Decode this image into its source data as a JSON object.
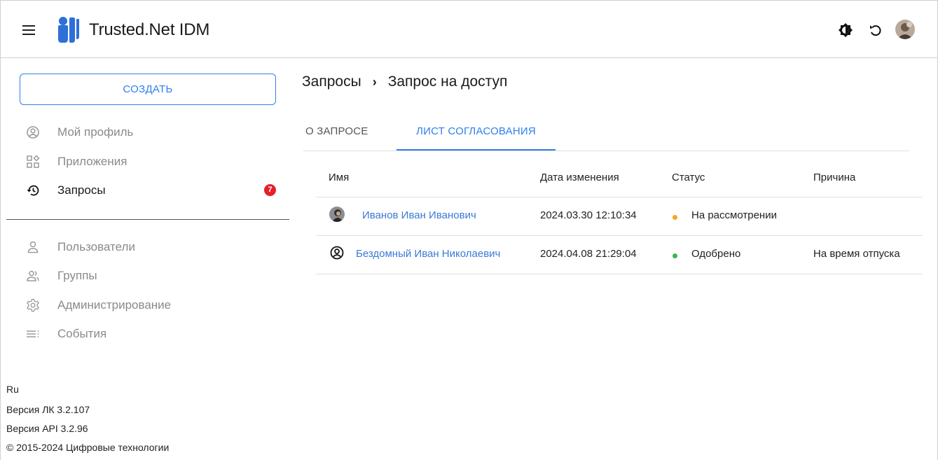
{
  "header": {
    "app_title": "Trusted.Net IDM",
    "icons": [
      "hamburger-menu-icon",
      "logo-icon",
      "theme-toggle-icon",
      "refresh-icon",
      "user-avatar"
    ]
  },
  "sidebar": {
    "create_label": "СОЗДАТЬ",
    "items_top": [
      {
        "label": "Мой профиль",
        "icon": "profile-icon"
      },
      {
        "label": "Приложения",
        "icon": "apps-icon"
      },
      {
        "label": "Запросы",
        "icon": "history-icon",
        "badge": "7",
        "active": true
      }
    ],
    "items_admin": [
      {
        "label": "Пользователи",
        "icon": "user-icon"
      },
      {
        "label": "Группы",
        "icon": "group-icon"
      },
      {
        "label": "Администрирование",
        "icon": "settings-icon"
      },
      {
        "label": "События",
        "icon": "events-icon"
      }
    ],
    "footer": {
      "language": "Ru",
      "version_lk": "Версия ЛК 3.2.107",
      "version_api": "Версия API 3.2.96",
      "copyright": "© 2015-2024 Цифровые технологии"
    }
  },
  "main": {
    "breadcrumb": {
      "parent": "Запросы",
      "current": "Запрос на доступ"
    },
    "tabs": [
      {
        "label": "О ЗАПРОСЕ",
        "active": false
      },
      {
        "label": "ЛИСТ СОГЛАСОВАНИЯ",
        "active": true
      }
    ],
    "table": {
      "headers": [
        "Имя",
        "Дата изменения",
        "Статус",
        "Причина"
      ],
      "rows": [
        {
          "name": "Иванов Иван Иванович",
          "date": "2024.03.30 12:10:34",
          "status": "На рассмотрении",
          "status_color": "#f5a623",
          "reason": ""
        },
        {
          "name": "Бездомный Иван Николаевич",
          "date": "2024.04.08 21:29:04",
          "status": "Одобрено",
          "status_color": "#3bb54a",
          "reason": "На время отпуска"
        }
      ]
    }
  },
  "colors": {
    "accent": "#2f80ed",
    "badge": "#e5202b"
  }
}
